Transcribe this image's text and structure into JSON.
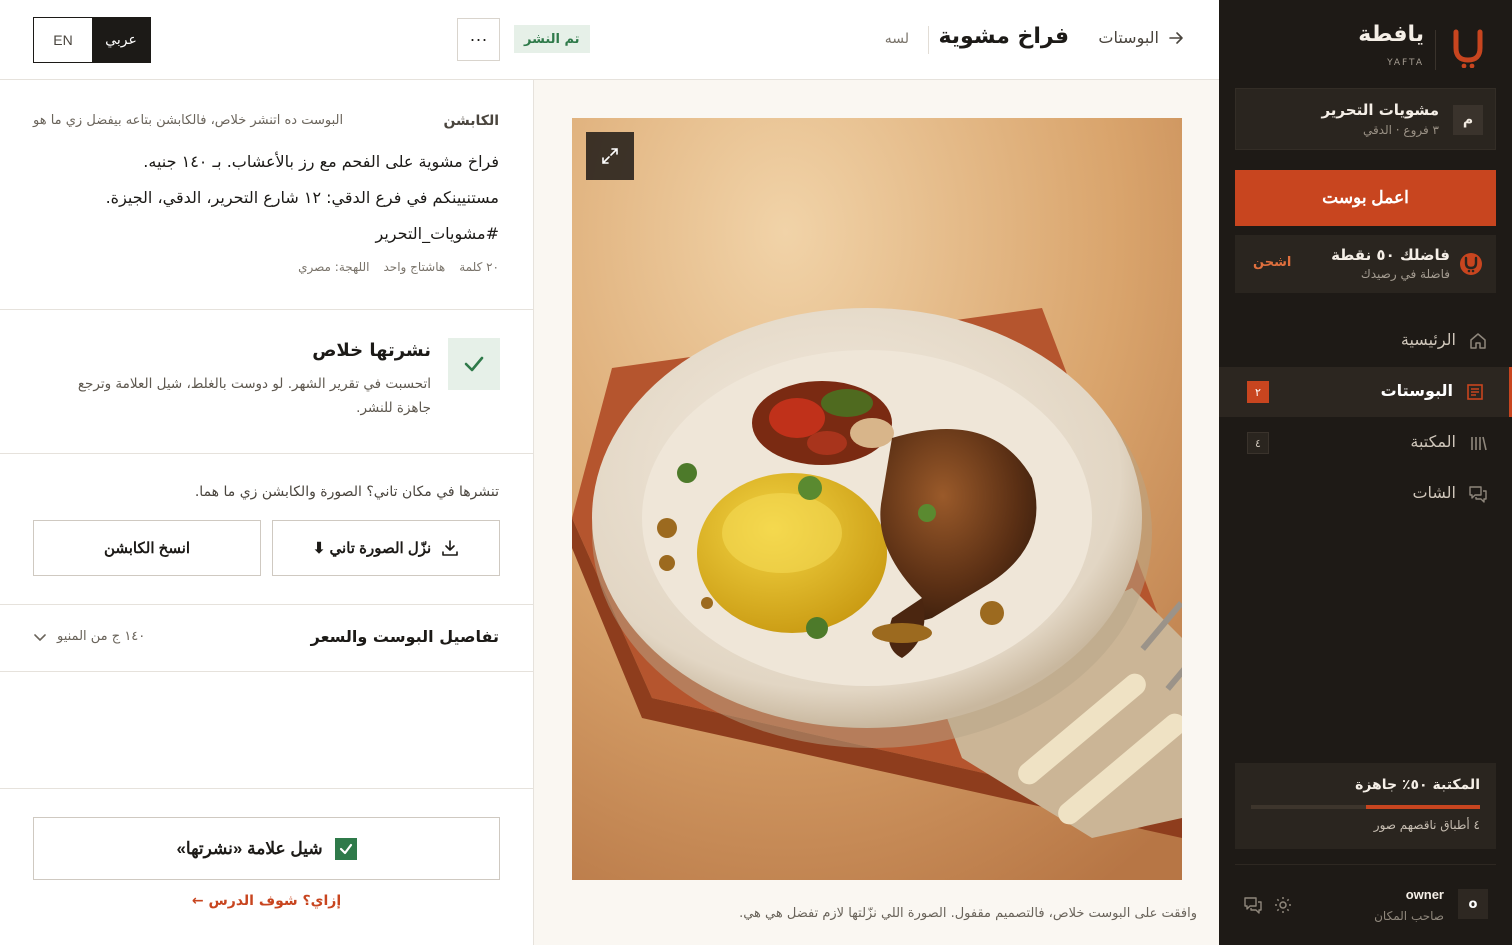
{
  "brand": {
    "name": "يافطة",
    "sub": "YAFTA",
    "accent": "#c8451f",
    "sidebar_bg": "#1e1a16"
  },
  "branch": {
    "avatar": "م",
    "name": "مشويات التحرير",
    "meta": "٣ فروع · الدقي"
  },
  "actions": {
    "create_post": "اعمل بوست"
  },
  "points": {
    "title": "فاضلك ٥٠ نقطة",
    "sub": "فاضلة في رصيدك",
    "link": "اشحن"
  },
  "nav": [
    {
      "label": "الرئيسية",
      "icon": "home-icon",
      "badge": ""
    },
    {
      "label": "البوستات",
      "icon": "posts-icon",
      "badge": "٢",
      "active": true
    },
    {
      "label": "المكتبة",
      "icon": "library-icon",
      "badge": "٤"
    },
    {
      "label": "الشات",
      "icon": "chat-icon",
      "badge": ""
    }
  ],
  "library": {
    "title": "المكتبة ٥٠٪ جاهزة",
    "progress": 0.5,
    "sub": "٤ أطباق ناقصهم صور"
  },
  "user": {
    "avatar": "o",
    "name": "owner",
    "role": "صاحب المكان"
  },
  "topbar": {
    "back_label": "البوستات",
    "title": "فراخ مشوية",
    "time": "لسه",
    "status": "تم النشر",
    "more": "···",
    "lang": {
      "ar": "عربي",
      "en": "EN"
    }
  },
  "image": {
    "alt": "grilled-chicken-plate",
    "note": "وافقت على البوست خلاص، فالتصميم مقفول. الصورة اللي نزّلتها لازم تفضل هي هي."
  },
  "caption": {
    "label": "الكابشن",
    "hint": "البوست ده اتنشر خلاص، فالكابشن بتاعه بيفضل زي ما هو",
    "lines": [
      "فراخ مشوية على الفحم مع رز بالأعشاب. بـ ١٤٠ جنيه.",
      "مستنيينكم في فرع الدقي: ١٢ شارع التحرير، الدقي، الجيزة.",
      "#مشويات_التحرير"
    ],
    "meta": {
      "words": "٢٠ كلمة",
      "hashtags": "هاشتاج واحد",
      "dialect": "اللهجة: مصري"
    }
  },
  "published": {
    "title": "نشرتها خلاص",
    "desc": "اتحسبت في تقرير الشهر. لو دوست بالغلط، شيل العلامة وترجع جاهزة للنشر."
  },
  "share": {
    "question": "تنشرها في مكان تاني؟ الصورة والكابشن زي ما هما.",
    "download": "نزّل الصورة تاني ⬇",
    "copy": "انسخ الكابشن"
  },
  "details_accordion": {
    "title": "تفاصيل البوست والسعر",
    "summary": "١٤٠ ج من المنيو"
  },
  "unmark": {
    "label": "شيل علامة «نشرتها»"
  },
  "lesson": {
    "label": "إزاي؟ شوف الدرس ←"
  }
}
